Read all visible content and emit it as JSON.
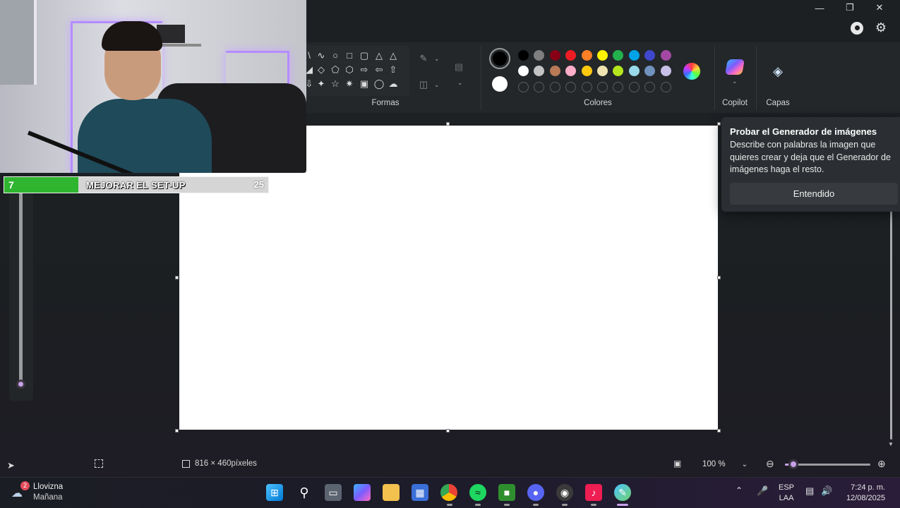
{
  "ribbon": {
    "shapes_label": "Formas",
    "colors_label": "Colores",
    "copilot_label": "Copilot",
    "layers_label": "Capas",
    "palette_row1": [
      "#000000",
      "#7f7f7f",
      "#880015",
      "#ed1c24",
      "#ff7f27",
      "#fff200",
      "#22b14c",
      "#00a2e8",
      "#3f48cc",
      "#a349a4"
    ],
    "palette_row2": [
      "#ffffff",
      "#c3c3c3",
      "#b97a57",
      "#ffaec9",
      "#ffc90e",
      "#efe4b0",
      "#b5e61d",
      "#99d9ea",
      "#7092be",
      "#c8bfe7"
    ],
    "primary_color": "#000000",
    "secondary_color": "#ffffff"
  },
  "popup": {
    "title": "Probar el Generador de imágenes",
    "body": "Describe con palabras la imagen que quieres crear y deja que el Generador de imágenes haga el resto.",
    "button": "Entendido"
  },
  "goal": {
    "current": "7",
    "label": "MEJORAR EL SET-UP",
    "target": "25",
    "progress": 0.28
  },
  "status": {
    "canvas_size": "816 × 460píxeles",
    "zoom": "100 %",
    "zoom_level": 0.1
  },
  "taskbar": {
    "weather_badge": "2",
    "weather_title": "Llovizna",
    "weather_sub": "Mañana",
    "lang_line1": "ESP",
    "lang_line2": "LAA",
    "time": "7:24 p. m.",
    "date": "12/08/2025"
  }
}
